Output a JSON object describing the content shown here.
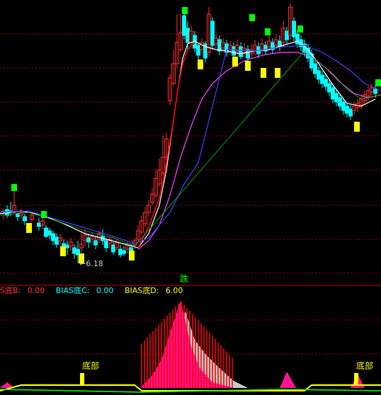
{
  "colors": {
    "background": "#000000",
    "grid": "#8b0000",
    "candle_up": "#ff3030",
    "candle_down": "#00ffff",
    "signal_yellow": "#ffff00",
    "signal_green": "#00ff00",
    "ma_white": "#ffffff",
    "ma_red": "#ff0000",
    "ma_magenta": "#ff40ff",
    "ma_blue": "#4040ff",
    "ma_green": "#00c000",
    "bias_b": "#ff3030",
    "bias_c": "#00ffff",
    "bias_d": "#ffff00",
    "hist_red": "#ff0000",
    "hist_magenta": "#ff1493",
    "hist_gray": "#c8c8c8"
  },
  "price_panel": {
    "low_marker_text": "6.18",
    "low_marker_icon": "arrow-left-icon"
  },
  "divider_label": "跌",
  "indicator": {
    "b_label": "S底B:",
    "b_value": "0.00",
    "c_label": "BIAS底C:",
    "c_value": "0.00",
    "d_label": "BIAS底D:",
    "d_value": "6.00"
  },
  "bottom_signals": [
    "底部",
    "底部"
  ]
}
